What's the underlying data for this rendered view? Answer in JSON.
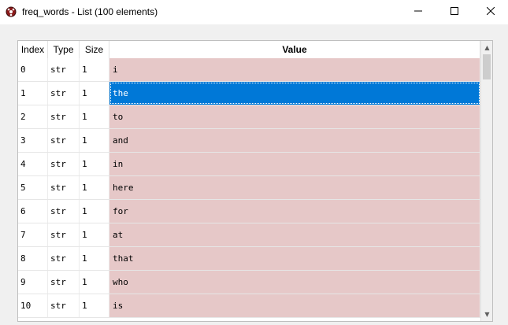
{
  "window": {
    "title": "freq_words - List (100 elements)",
    "minimize_glyph": "—",
    "maximize_glyph": "☐",
    "close_glyph": "✕"
  },
  "table": {
    "headers": {
      "index": "Index",
      "type": "Type",
      "size": "Size",
      "value": "Value"
    },
    "sort_indicator": "^",
    "selected_row": 1,
    "rows": [
      {
        "index": "0",
        "type": "str",
        "size": "1",
        "value": "i"
      },
      {
        "index": "1",
        "type": "str",
        "size": "1",
        "value": "the"
      },
      {
        "index": "2",
        "type": "str",
        "size": "1",
        "value": "to"
      },
      {
        "index": "3",
        "type": "str",
        "size": "1",
        "value": "and"
      },
      {
        "index": "4",
        "type": "str",
        "size": "1",
        "value": "in"
      },
      {
        "index": "5",
        "type": "str",
        "size": "1",
        "value": "here"
      },
      {
        "index": "6",
        "type": "str",
        "size": "1",
        "value": "for"
      },
      {
        "index": "7",
        "type": "str",
        "size": "1",
        "value": "at"
      },
      {
        "index": "8",
        "type": "str",
        "size": "1",
        "value": "that"
      },
      {
        "index": "9",
        "type": "str",
        "size": "1",
        "value": "who"
      },
      {
        "index": "10",
        "type": "str",
        "size": "1",
        "value": "is"
      }
    ]
  },
  "scrollbar": {
    "up_glyph": "▲",
    "down_glyph": "▼"
  },
  "colors": {
    "value_cell_bg": "#e6c8c8",
    "selection_bg": "#0078d7"
  }
}
